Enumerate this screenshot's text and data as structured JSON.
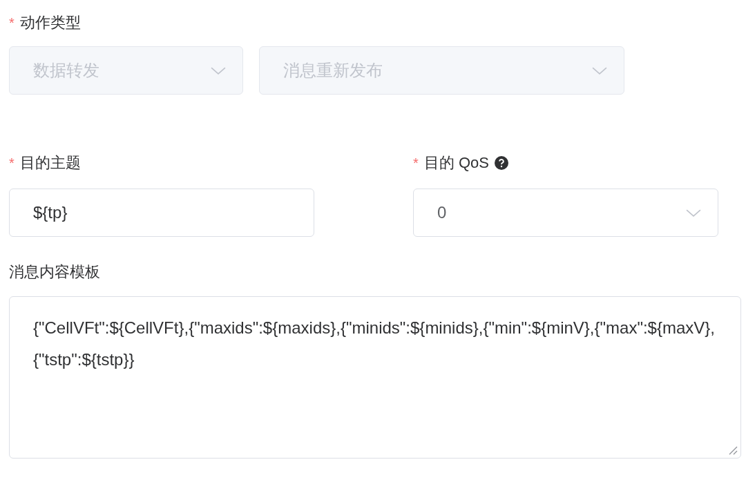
{
  "action_type": {
    "marker": "*",
    "label": "动作类型",
    "selects": [
      {
        "value": "数据转发",
        "disabled": true
      },
      {
        "value": "消息重新发布",
        "disabled": true
      }
    ]
  },
  "target_topic": {
    "marker": "*",
    "label": "目的主题",
    "value": "${tp}"
  },
  "target_qos": {
    "marker": "*",
    "label": "目的 QoS",
    "value": "0",
    "disabled": false
  },
  "template": {
    "label": "消息内容模板",
    "value": "{\"CellVFt\":${CellVFt},{\"maxids\":${maxids},{\"minids\":${minids},{\"min\":${minV},{\"max\":${maxV},{\"tstp\":${tstp}}"
  }
}
